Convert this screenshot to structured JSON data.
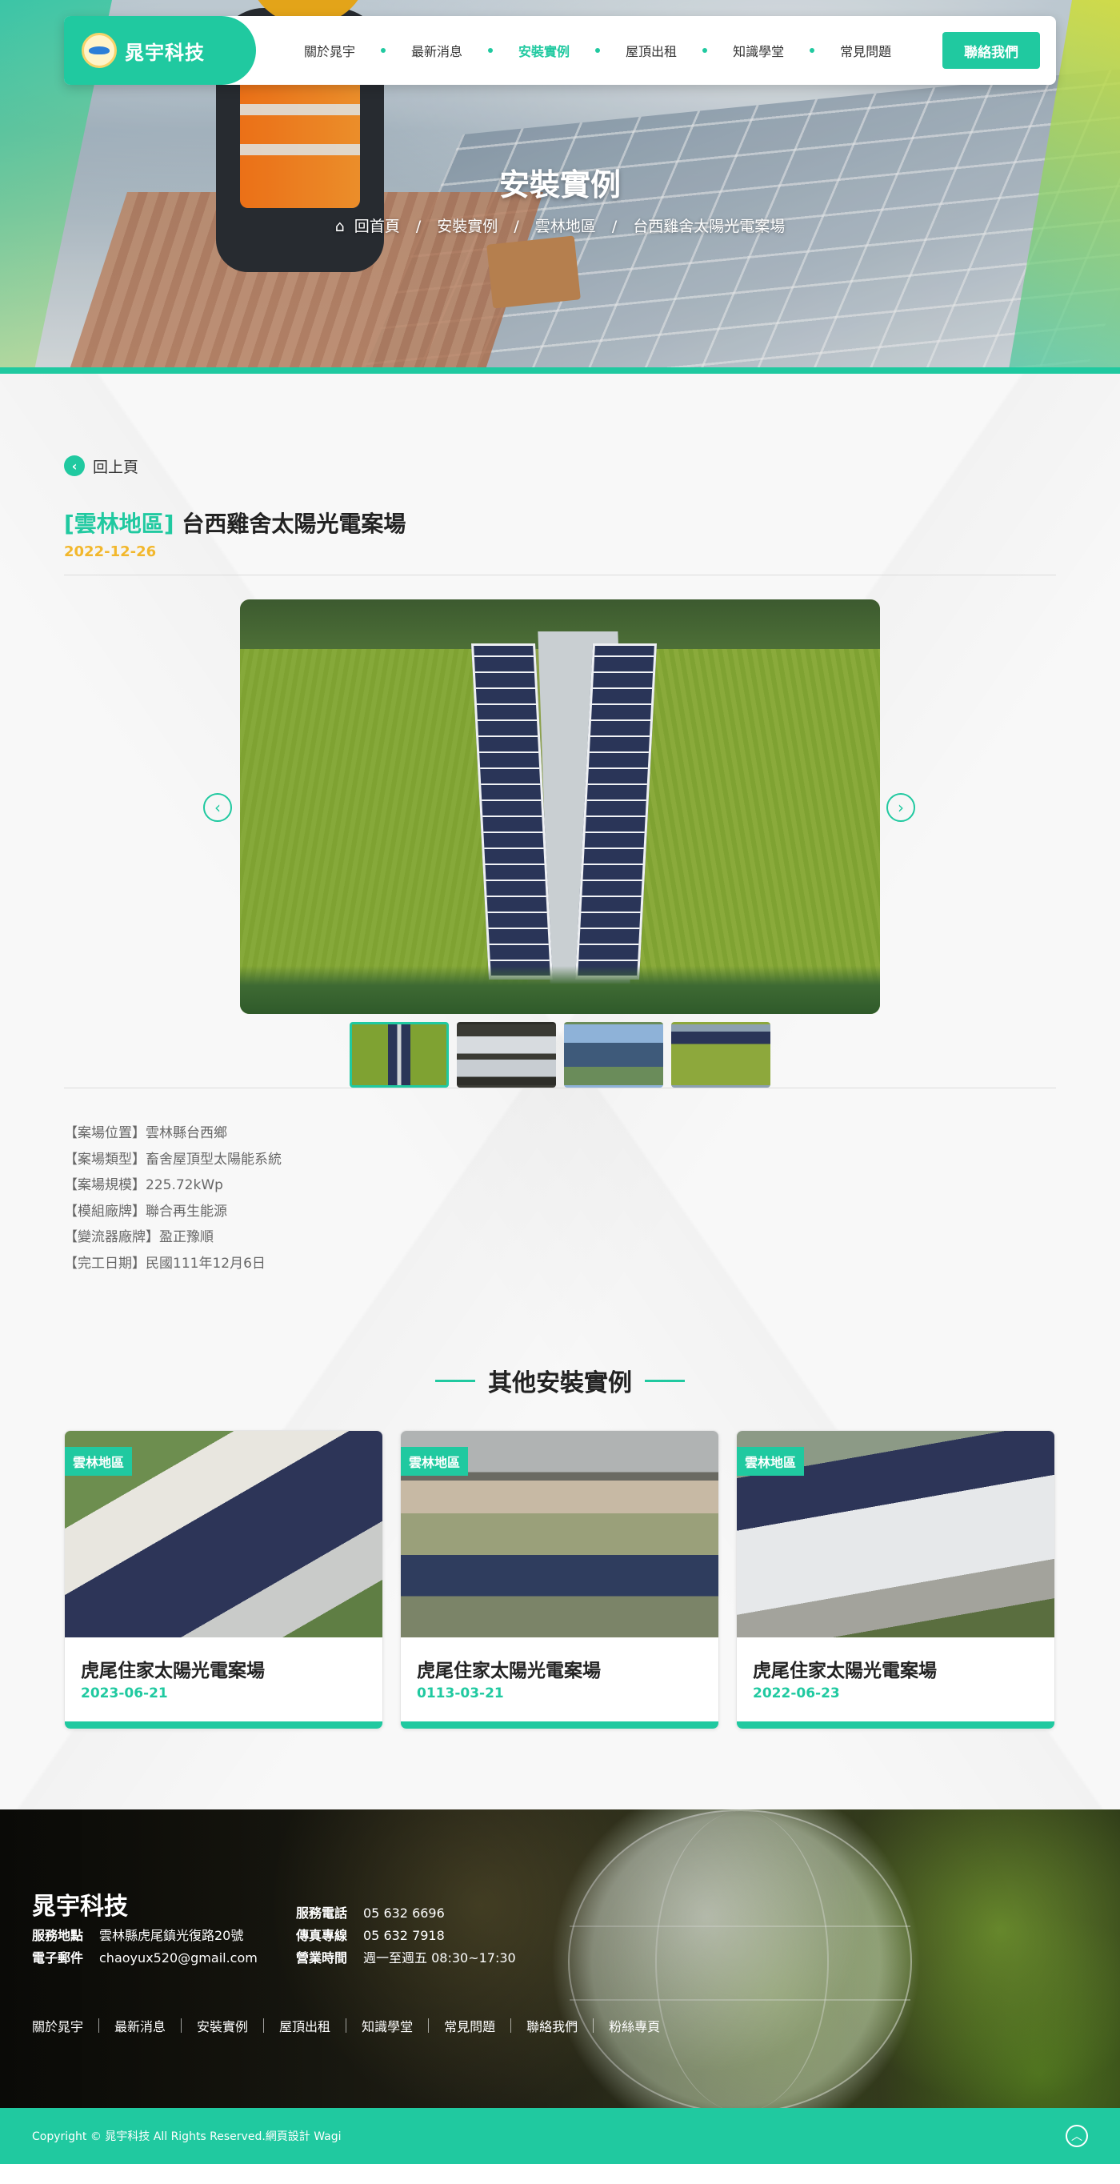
{
  "brand": {
    "name": "晁宇科技"
  },
  "nav": {
    "items": [
      {
        "label": "關於晁宇",
        "active": false
      },
      {
        "label": "最新消息",
        "active": false
      },
      {
        "label": "安裝實例",
        "active": true
      },
      {
        "label": "屋頂出租",
        "active": false
      },
      {
        "label": "知識學堂",
        "active": false
      },
      {
        "label": "常見問題",
        "active": false
      }
    ],
    "contact_label": "聯絡我們"
  },
  "hero": {
    "title": "安裝實例",
    "breadcrumb": [
      "回首頁",
      "安裝實例",
      "雲林地區",
      "台西雞舍太陽光電案場"
    ]
  },
  "case": {
    "back_label": "回上頁",
    "region": "[雲林地區]",
    "title": "台西雞舍太陽光電案場",
    "date": "2022-12-26",
    "specs": [
      "【案場位置】雲林縣台西鄉",
      "【案場類型】畜舍屋頂型太陽能系統",
      "【案場規模】225.72kWp",
      "【模組廠牌】聯合再生能源",
      "【變流器廠牌】盈正豫順",
      "【完工日期】民國111年12月6日"
    ]
  },
  "others": {
    "title": "其他安裝實例",
    "cards": [
      {
        "tag": "雲林地區",
        "title": "虎尾住家太陽光電案場",
        "date": "2023-06-21"
      },
      {
        "tag": "雲林地區",
        "title": "虎尾住家太陽光電案場",
        "date": "0113-03-21"
      },
      {
        "tag": "雲林地區",
        "title": "虎尾住家太陽光電案場",
        "date": "2022-06-23"
      }
    ]
  },
  "footer": {
    "brand": "晁宇科技",
    "address_label": "服務地點",
    "address": "雲林縣虎尾鎮光復路20號",
    "email_label": "電子郵件",
    "email": "chaoyux520@gmail.com",
    "phone_label": "服務電話",
    "phone": "05 632 6696",
    "fax_label": "傳真專線",
    "fax": "05 632 7918",
    "hours_label": "營業時間",
    "hours": "週一至週五 08:30~17:30",
    "links": [
      "關於晁宇",
      "最新消息",
      "安裝實例",
      "屋頂出租",
      "知識學堂",
      "常見問題",
      "聯絡我們",
      "粉絲專頁"
    ],
    "copyright": "Copyright © 晁宇科技 All Rights Reserved.網頁設計 Wagi"
  },
  "colors": {
    "accent": "#20c9a0",
    "date": "#f2b72c"
  },
  "icons": {
    "home": "home-icon",
    "back": "back-arrow-icon",
    "prev": "chevron-left-icon",
    "next": "chevron-right-icon",
    "top": "chevron-up-icon"
  }
}
